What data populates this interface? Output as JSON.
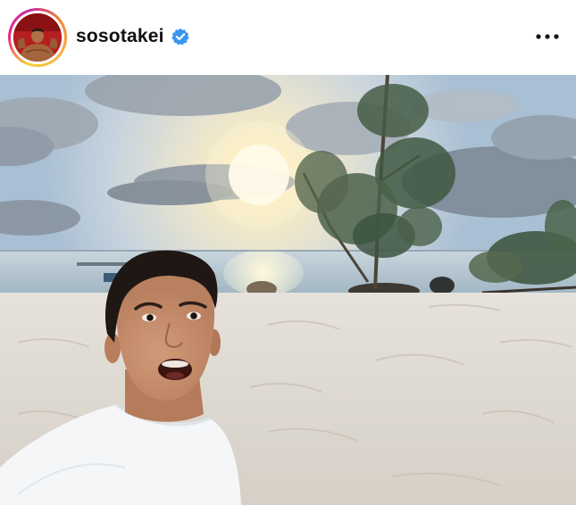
{
  "post": {
    "username": "sosotakei",
    "verified": true,
    "header_icons": {
      "avatar": "profile-avatar",
      "verified": "verified-badge-icon",
      "more": "more-options-icon"
    },
    "colors": {
      "verified_blue": "#3897f0",
      "username_text": "#111111",
      "story_ring": [
        "#f9ce34",
        "#ee2a7b",
        "#c32aa3"
      ]
    },
    "image": {
      "description_icon": "beach-selfie-photo"
    }
  }
}
